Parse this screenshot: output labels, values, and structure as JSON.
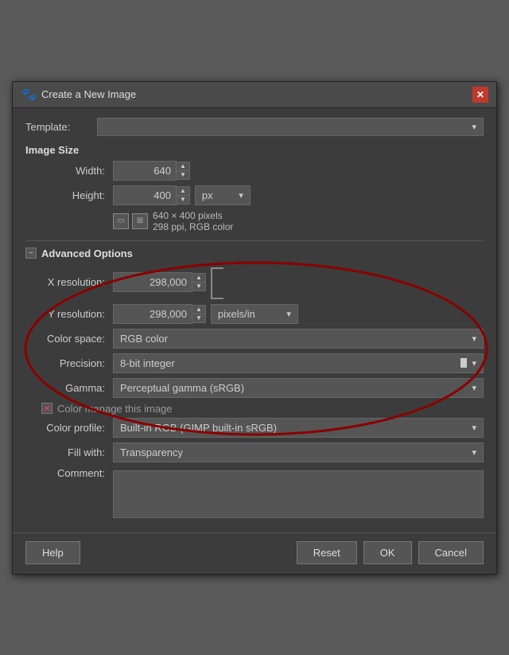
{
  "dialog": {
    "title": "Create a New Image",
    "close_label": "✕"
  },
  "template": {
    "label": "Template:",
    "label_underline_char": "T",
    "value": "",
    "placeholder": ""
  },
  "image_size": {
    "section_label": "Image Size",
    "width_label": "Width:",
    "width_underline_char": "W",
    "width_value": "640",
    "height_label": "Height:",
    "height_underline_char": "H",
    "height_value": "400",
    "unit": "px",
    "info_text": "640 × 400 pixels",
    "info_text2": "298 ppi, RGB color"
  },
  "advanced": {
    "section_label": "Advanced Options",
    "section_underline_char": "A",
    "x_resolution_label": "X resolution:",
    "x_resolution_underline_char": "X",
    "x_resolution_value": "298,000",
    "y_resolution_label": "Y resolution:",
    "y_resolution_underline_char": "Y",
    "y_resolution_value": "298,000",
    "resolution_unit": "pixels/in",
    "color_space_label": "Color space:",
    "color_space_underline_char": "C",
    "color_space_value": "RGB color",
    "precision_label": "Precision:",
    "precision_underline_char": "P",
    "precision_value": "8-bit integer",
    "gamma_label": "Gamma:",
    "gamma_underline_char": "G",
    "gamma_value": "Perceptual gamma (sRGB)",
    "color_manage_label": "Color manage this image",
    "color_manage_underline_char": "m",
    "color_profile_label": "Color profile:",
    "color_profile_underline_char": "o",
    "color_profile_value": "Built-in RGB (GIMP built-in sRGB)",
    "fill_with_label": "Fill with:",
    "fill_with_underline_char": "F",
    "fill_with_value": "Transparency",
    "comment_label": "Comment:",
    "comment_underline_char": "C"
  },
  "buttons": {
    "help": "Help",
    "help_underline_char": "H",
    "reset": "Reset",
    "reset_underline_char": "R",
    "ok": "OK",
    "ok_underline_char": "O",
    "cancel": "Cancel",
    "cancel_underline_char": "C"
  }
}
